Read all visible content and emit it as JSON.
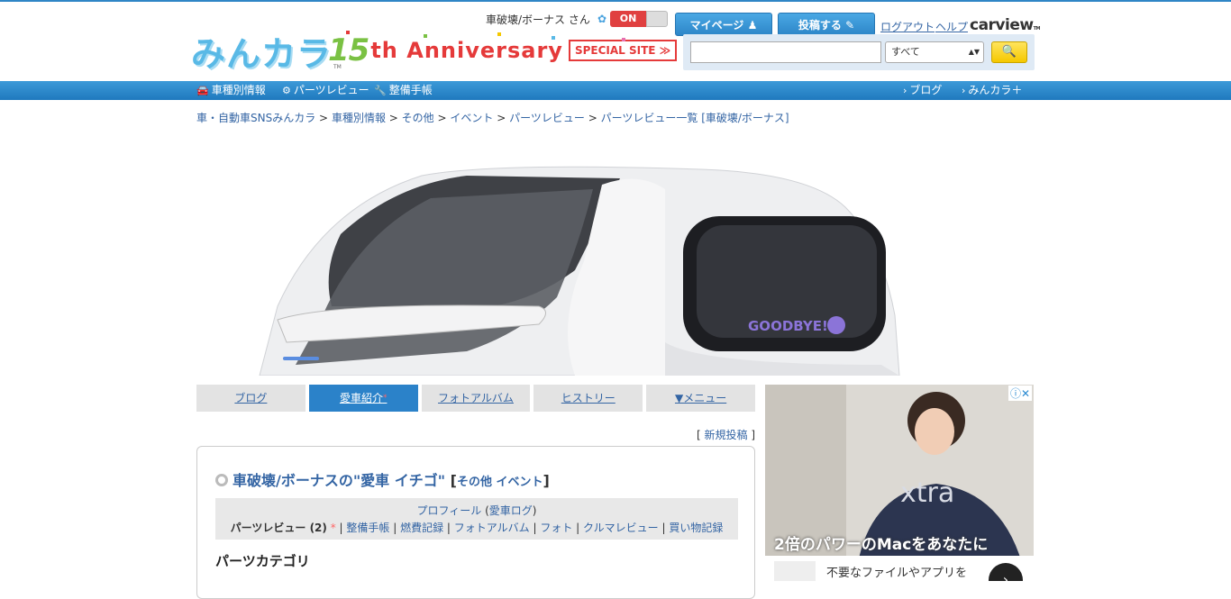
{
  "header": {
    "user_name": "車破壊/ボーナス さん",
    "toggle_label": "ON",
    "mypage_label": "マイページ",
    "post_label": "投稿する",
    "logout_label": "ログアウト",
    "help_label": "ヘルプ",
    "carview_label": "carview",
    "logo_text": "みんカラ",
    "anniversary_num": "15",
    "anniversary_text": "th Anniversary",
    "special_site_label": "SPECIAL SITE ≫"
  },
  "search": {
    "placeholder": "",
    "category_selected": "すべて"
  },
  "nav": {
    "items": [
      {
        "label": "車種別情報",
        "icon": "car-icon"
      },
      {
        "label": "パーツレビュー",
        "icon": "gear-icon"
      },
      {
        "label": "整備手帳",
        "icon": "wrench-icon"
      }
    ],
    "right_items": [
      {
        "label": "ブログ"
      },
      {
        "label": "みんカラ＋"
      }
    ]
  },
  "breadcrumb": {
    "items": [
      "車・自動車SNSみんカラ",
      "車種別情報",
      "その他",
      "イベント",
      "パーツレビュー",
      "パーツレビュー一覧 [車破壊/ボーナス]"
    ],
    "separator": ">"
  },
  "hero": {
    "car_text": "GOODBYE!"
  },
  "tabs": [
    {
      "label": "ブログ"
    },
    {
      "label": "愛車紹介",
      "active": true,
      "mark": "*"
    },
    {
      "label": "フォトアルバム"
    },
    {
      "label": "ヒストリー"
    },
    {
      "label": "▼メニュー"
    }
  ],
  "newpost": {
    "open": "[",
    "label": "新規投稿",
    "close": "]"
  },
  "panel": {
    "title": "車破壊/ボーナスの\"愛車 イチゴ\"",
    "tag_open": "[",
    "tag_label": "その他 イベント",
    "tag_close": "]",
    "subnav_row1": {
      "profile": "プロフィール",
      "car_log": "愛車ログ"
    },
    "subnav_row2": {
      "parts_review": "パーツレビュー (2)",
      "mark": "*",
      "maintenance": "整備手帳",
      "fuel": "燃費記録",
      "photo_album": "フォトアルバム",
      "photo": "フォト",
      "car_review": "クルマレビュー",
      "purchase": "買い物記録"
    },
    "section_heading": "パーツカテゴリ"
  },
  "ad": {
    "headline": "2倍のパワーのMacをあなたに",
    "subtext": "不要なファイルやアプリを",
    "shirt_text": "xtra"
  }
}
